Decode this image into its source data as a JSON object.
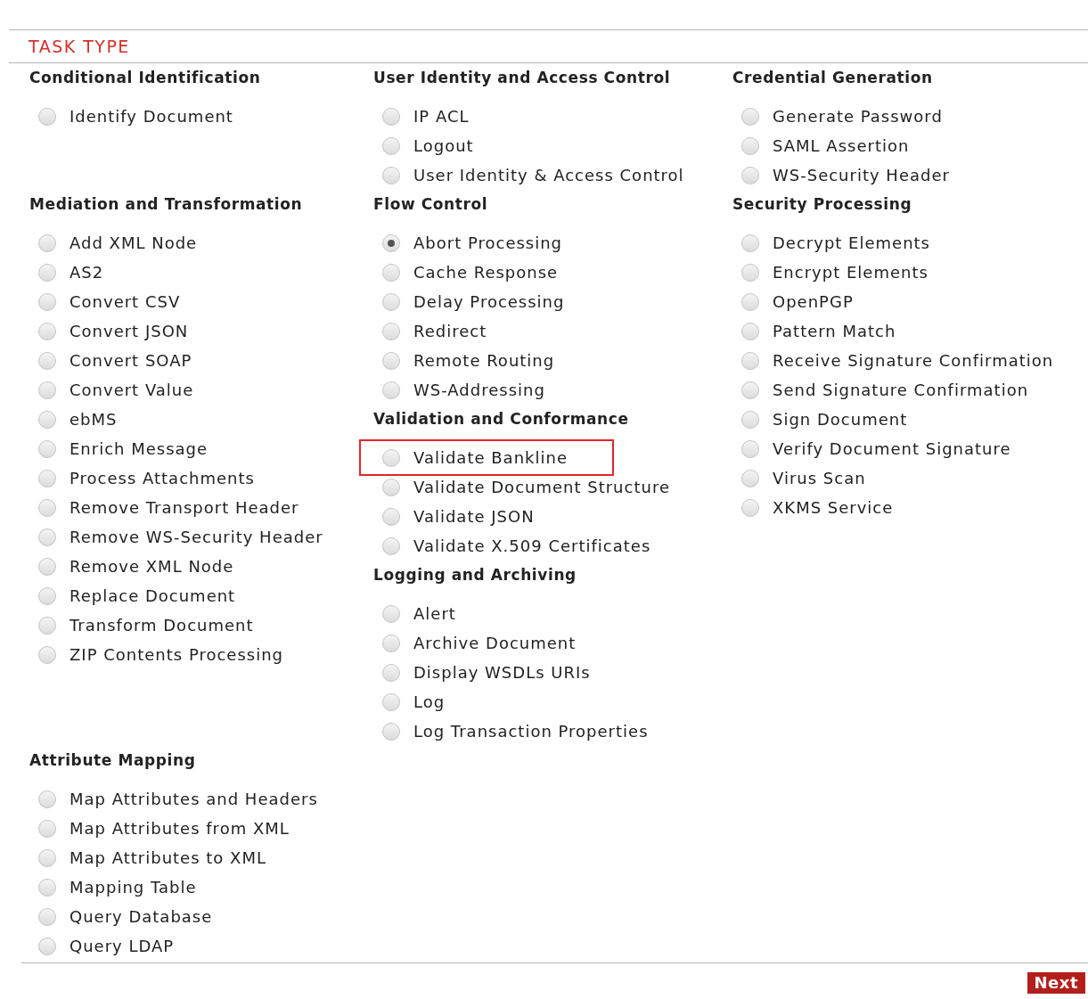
{
  "section_title": "TASK TYPE",
  "rows": [
    {
      "columns": [
        {
          "groups": [
            {
              "title": "Conditional Identification",
              "items": [
                {
                  "label": "Identify Document",
                  "selected": false,
                  "highlighted": false
                }
              ]
            }
          ]
        },
        {
          "groups": [
            {
              "title": "User Identity and Access Control",
              "items": [
                {
                  "label": "IP ACL",
                  "selected": false,
                  "highlighted": false
                },
                {
                  "label": "Logout",
                  "selected": false,
                  "highlighted": false
                },
                {
                  "label": "User Identity & Access Control",
                  "selected": false,
                  "highlighted": false
                }
              ]
            }
          ]
        },
        {
          "groups": [
            {
              "title": "Credential Generation",
              "items": [
                {
                  "label": "Generate Password",
                  "selected": false,
                  "highlighted": false
                },
                {
                  "label": "SAML Assertion",
                  "selected": false,
                  "highlighted": false
                },
                {
                  "label": "WS-Security Header",
                  "selected": false,
                  "highlighted": false
                }
              ]
            }
          ]
        }
      ]
    },
    {
      "columns": [
        {
          "groups": [
            {
              "title": "Mediation and Transformation",
              "items": [
                {
                  "label": "Add XML Node",
                  "selected": false,
                  "highlighted": false
                },
                {
                  "label": "AS2",
                  "selected": false,
                  "highlighted": false
                },
                {
                  "label": "Convert CSV",
                  "selected": false,
                  "highlighted": false
                },
                {
                  "label": "Convert JSON",
                  "selected": false,
                  "highlighted": false
                },
                {
                  "label": "Convert SOAP",
                  "selected": false,
                  "highlighted": false
                },
                {
                  "label": "Convert Value",
                  "selected": false,
                  "highlighted": false
                },
                {
                  "label": "ebMS",
                  "selected": false,
                  "highlighted": false
                },
                {
                  "label": "Enrich Message",
                  "selected": false,
                  "highlighted": false
                },
                {
                  "label": "Process Attachments",
                  "selected": false,
                  "highlighted": false
                },
                {
                  "label": "Remove Transport Header",
                  "selected": false,
                  "highlighted": false
                },
                {
                  "label": "Remove WS-Security Header",
                  "selected": false,
                  "highlighted": false
                },
                {
                  "label": "Remove XML Node",
                  "selected": false,
                  "highlighted": false
                },
                {
                  "label": "Replace Document",
                  "selected": false,
                  "highlighted": false
                },
                {
                  "label": "Transform Document",
                  "selected": false,
                  "highlighted": false
                },
                {
                  "label": "ZIP Contents Processing",
                  "selected": false,
                  "highlighted": false
                }
              ]
            }
          ]
        },
        {
          "groups": [
            {
              "title": "Flow Control",
              "items": [
                {
                  "label": "Abort Processing",
                  "selected": true,
                  "highlighted": false
                },
                {
                  "label": "Cache Response",
                  "selected": false,
                  "highlighted": false
                },
                {
                  "label": "Delay Processing",
                  "selected": false,
                  "highlighted": false
                },
                {
                  "label": "Redirect",
                  "selected": false,
                  "highlighted": false
                },
                {
                  "label": "Remote Routing",
                  "selected": false,
                  "highlighted": false
                },
                {
                  "label": "WS-Addressing",
                  "selected": false,
                  "highlighted": false
                }
              ]
            },
            {
              "title": "Validation and Conformance",
              "items": [
                {
                  "label": "Validate Bankline",
                  "selected": false,
                  "highlighted": true
                },
                {
                  "label": "Validate Document Structure",
                  "selected": false,
                  "highlighted": false
                },
                {
                  "label": "Validate JSON",
                  "selected": false,
                  "highlighted": false
                },
                {
                  "label": "Validate X.509 Certificates",
                  "selected": false,
                  "highlighted": false
                }
              ]
            },
            {
              "title": "Logging and Archiving",
              "items": [
                {
                  "label": "Alert",
                  "selected": false,
                  "highlighted": false
                },
                {
                  "label": "Archive Document",
                  "selected": false,
                  "highlighted": false
                },
                {
                  "label": "Display WSDLs URIs",
                  "selected": false,
                  "highlighted": false
                },
                {
                  "label": "Log",
                  "selected": false,
                  "highlighted": false
                },
                {
                  "label": "Log Transaction Properties",
                  "selected": false,
                  "highlighted": false
                }
              ]
            }
          ]
        },
        {
          "groups": [
            {
              "title": "Security Processing",
              "items": [
                {
                  "label": "Decrypt Elements",
                  "selected": false,
                  "highlighted": false
                },
                {
                  "label": "Encrypt Elements",
                  "selected": false,
                  "highlighted": false
                },
                {
                  "label": "OpenPGP",
                  "selected": false,
                  "highlighted": false
                },
                {
                  "label": "Pattern Match",
                  "selected": false,
                  "highlighted": false
                },
                {
                  "label": "Receive Signature Confirmation",
                  "selected": false,
                  "highlighted": false
                },
                {
                  "label": "Send Signature Confirmation",
                  "selected": false,
                  "highlighted": false
                },
                {
                  "label": "Sign Document",
                  "selected": false,
                  "highlighted": false
                },
                {
                  "label": "Verify Document Signature",
                  "selected": false,
                  "highlighted": false
                },
                {
                  "label": "Virus Scan",
                  "selected": false,
                  "highlighted": false
                },
                {
                  "label": "XKMS Service",
                  "selected": false,
                  "highlighted": false
                }
              ]
            }
          ]
        }
      ]
    },
    {
      "columns": [
        {
          "groups": [
            {
              "title": "Attribute Mapping",
              "items": [
                {
                  "label": "Map Attributes and Headers",
                  "selected": false,
                  "highlighted": false
                },
                {
                  "label": "Map Attributes from XML",
                  "selected": false,
                  "highlighted": false
                },
                {
                  "label": "Map Attributes to XML",
                  "selected": false,
                  "highlighted": false
                },
                {
                  "label": "Mapping Table",
                  "selected": false,
                  "highlighted": false
                },
                {
                  "label": "Query Database",
                  "selected": false,
                  "highlighted": false
                },
                {
                  "label": "Query LDAP",
                  "selected": false,
                  "highlighted": false
                }
              ]
            }
          ]
        }
      ]
    }
  ],
  "next_button": "Next"
}
